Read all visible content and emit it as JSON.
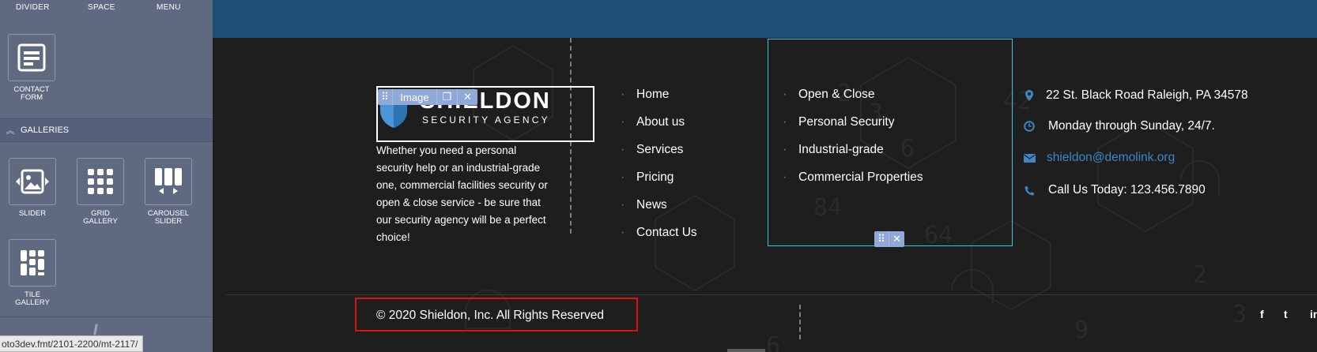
{
  "panel": {
    "top_tabs": [
      "DIVIDER",
      "SPACE",
      "MENU"
    ],
    "contact_widget": "CONTACT\nFORM",
    "galleries_title": "GALLERIES",
    "gallery_widgets": [
      "SLIDER",
      "GRID\nGALLERY",
      "CAROUSEL\nSLIDER"
    ],
    "tile_widget": "TILE\nGALLERY",
    "status_url": "oto3dev.fmt/2101-2200/mt-2117/"
  },
  "footer": {
    "image_toolbar_label": "Image",
    "logo_name": "SHIELDON",
    "logo_tagline": "SECURITY AGENCY",
    "about": "Whether you need a personal security help or an industrial-grade one, commercial facilities security or open & close service - be sure that our security agency will be a perfect choice!",
    "nav": [
      "Home",
      "About us",
      "Services",
      "Pricing",
      "News",
      "Contact Us"
    ],
    "services": [
      "Open & Close",
      "Personal Security",
      "Industrial-grade",
      "Commercial Properties"
    ],
    "contact": {
      "address": "22 St. Black Road Raleigh, PA 34578",
      "hours": "Monday through Sunday, 24/7.",
      "email": "shieldon@demolink.org",
      "phone": "Call Us Today: 123.456.7890"
    },
    "copyright": "© 2020 Shieldon, Inc. All Rights Reserved",
    "social": [
      "f",
      "t",
      "in"
    ]
  },
  "colors": {
    "panel": "#5f6a80",
    "top_band": "#1c4f73",
    "footer_bg": "#1d1d1d",
    "accent": "#3c87c4",
    "selection": "#3fc3d9",
    "highlight": "#e01111"
  }
}
